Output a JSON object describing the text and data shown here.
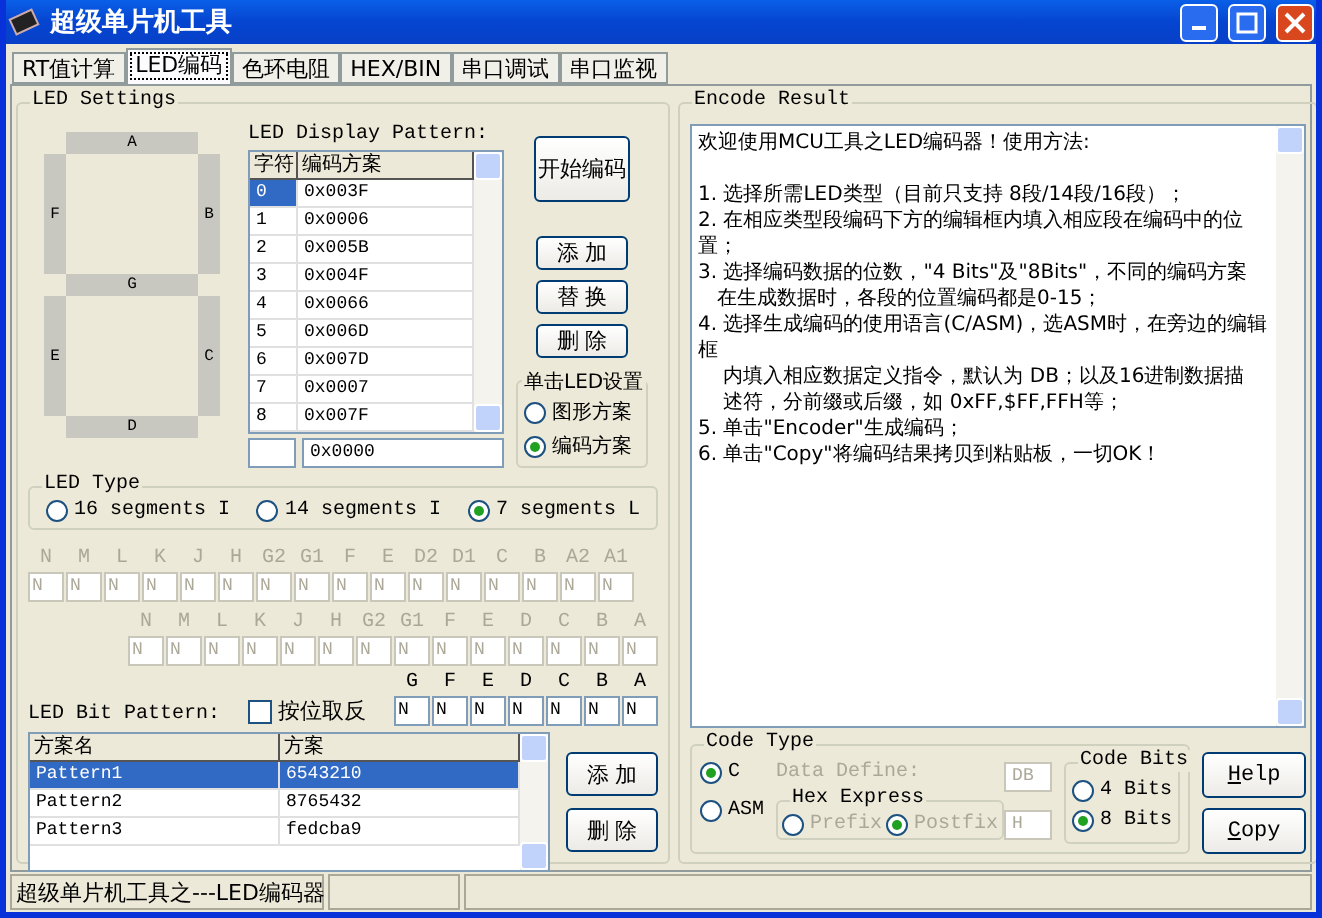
{
  "window": {
    "title": "超级单片机工具"
  },
  "tabs": [
    {
      "label": "RT值计算",
      "selected": false
    },
    {
      "label": "LED编码",
      "selected": true
    },
    {
      "label": "色环电阻",
      "selected": false
    },
    {
      "label": "HEX/BIN",
      "selected": false
    },
    {
      "label": "串口调试",
      "selected": false
    },
    {
      "label": "串口监视",
      "selected": false
    }
  ],
  "led_settings": {
    "title": "LED Settings",
    "segments": [
      "A",
      "F",
      "B",
      "G",
      "E",
      "C",
      "D"
    ],
    "pattern_title": "LED Display Pattern:",
    "pattern_columns": [
      "字符",
      "编码方案"
    ],
    "pattern_rows": [
      {
        "char": "0",
        "code": "0x003F",
        "selected": true
      },
      {
        "char": "1",
        "code": "0x0006",
        "selected": false
      },
      {
        "char": "2",
        "code": "0x005B",
        "selected": false
      },
      {
        "char": "3",
        "code": "0x004F",
        "selected": false
      },
      {
        "char": "4",
        "code": "0x0066",
        "selected": false
      },
      {
        "char": "5",
        "code": "0x006D",
        "selected": false
      },
      {
        "char": "6",
        "code": "0x007D",
        "selected": false
      },
      {
        "char": "7",
        "code": "0x0007",
        "selected": false
      },
      {
        "char": "8",
        "code": "0x007F",
        "selected": false
      }
    ],
    "code_input": "0x0000",
    "start_button": "开始编码",
    "buttons": [
      "添 加",
      "替 换",
      "删 除"
    ],
    "click_setting": {
      "title": "单击LED设置",
      "options": [
        {
          "label": "图形方案",
          "selected": false
        },
        {
          "label": "编码方案",
          "selected": true
        }
      ]
    }
  },
  "led_type": {
    "title": "LED Type",
    "options": [
      {
        "label": "16 segments I",
        "selected": false
      },
      {
        "label": "14 segments I",
        "selected": false
      },
      {
        "label": "7 segments L",
        "selected": true
      }
    ]
  },
  "segment_rows": [
    {
      "disabled": true,
      "fields": [
        {
          "label": "N",
          "value": "N"
        },
        {
          "label": "M",
          "value": "N"
        },
        {
          "label": "L",
          "value": "N"
        },
        {
          "label": "K",
          "value": "N"
        },
        {
          "label": "J",
          "value": "N"
        },
        {
          "label": "H",
          "value": "N"
        },
        {
          "label": "G2",
          "value": "N"
        },
        {
          "label": "G1",
          "value": "N"
        },
        {
          "label": "F",
          "value": "N"
        },
        {
          "label": "E",
          "value": "N"
        },
        {
          "label": "D2",
          "value": "N"
        },
        {
          "label": "D1",
          "value": "N"
        },
        {
          "label": "C",
          "value": "N"
        },
        {
          "label": "B",
          "value": "N"
        },
        {
          "label": "A2",
          "value": "N"
        },
        {
          "label": "A1",
          "value": "N"
        }
      ]
    },
    {
      "disabled": true,
      "fields": [
        {
          "label": "N",
          "value": "N"
        },
        {
          "label": "M",
          "value": "N"
        },
        {
          "label": "L",
          "value": "N"
        },
        {
          "label": "K",
          "value": "N"
        },
        {
          "label": "J",
          "value": "N"
        },
        {
          "label": "H",
          "value": "N"
        },
        {
          "label": "G2",
          "value": "N"
        },
        {
          "label": "G1",
          "value": "N"
        },
        {
          "label": "F",
          "value": "N"
        },
        {
          "label": "E",
          "value": "N"
        },
        {
          "label": "D",
          "value": "N"
        },
        {
          "label": "C",
          "value": "N"
        },
        {
          "label": "B",
          "value": "N"
        },
        {
          "label": "A",
          "value": "N"
        }
      ]
    },
    {
      "disabled": false,
      "fields": [
        {
          "label": "G",
          "value": "N"
        },
        {
          "label": "F",
          "value": "N"
        },
        {
          "label": "E",
          "value": "N"
        },
        {
          "label": "D",
          "value": "N"
        },
        {
          "label": "C",
          "value": "N"
        },
        {
          "label": "B",
          "value": "N"
        },
        {
          "label": "A",
          "value": "N"
        }
      ]
    }
  ],
  "bit_pattern": {
    "title": "LED Bit Pattern:",
    "invert": {
      "label": "按位取反",
      "checked": false
    },
    "columns": [
      "方案名",
      "方案"
    ],
    "rows": [
      {
        "name": "Pattern1",
        "pattern": "6543210",
        "selected": true
      },
      {
        "name": "Pattern2",
        "pattern": "8765432",
        "selected": false
      },
      {
        "name": "Pattern3",
        "pattern": "fedcba9",
        "selected": false
      }
    ],
    "buttons": [
      "添 加",
      "删 除"
    ]
  },
  "encode_result": {
    "title": "Encode Result",
    "paragraphs": [
      {
        "text": "欢迎使用MCU工具之LED编码器！使用方法:",
        "gap_after": true
      },
      {
        "text": "1. 选择所需LED类型（目前只支持 8段/14段/16段）；",
        "gap_after": false
      },
      {
        "text": "2. 在相应类型段编码下方的编辑框内填入相应段在编码中的位置；",
        "gap_after": false
      },
      {
        "text": "3. 选择编码数据的位数，\"4 Bits\"及\"8Bits\"，不同的编码方案",
        "gap_after": false
      },
      {
        "text": "   在生成数据时，各段的位置编码都是0-15；",
        "gap_after": false
      },
      {
        "text": "4. 选择生成编码的使用语言(C/ASM)，选ASM时，在旁边的编辑框",
        "gap_after": false
      },
      {
        "text": "    内填入相应数据定义指令，默认为 DB；以及16进制数据描",
        "gap_after": false
      },
      {
        "text": "    述符，分前缀或后缀，如 0xFF,$FF,FFH等；",
        "gap_after": false
      },
      {
        "text": "5. 单击\"Encoder\"生成编码；",
        "gap_after": false
      },
      {
        "text": "6. 单击\"Copy\"将编码结果拷贝到粘贴板，一切OK！",
        "gap_after": false
      }
    ]
  },
  "code_type": {
    "title": "Code Type",
    "options": [
      {
        "label": "C",
        "selected": true
      },
      {
        "label": "ASM",
        "selected": false
      }
    ],
    "data_define": {
      "label": "Data Define:",
      "value": "DB",
      "disabled": true
    },
    "hex_express": {
      "title": "Hex Express",
      "disabled": true,
      "options": [
        {
          "label": "Prefix",
          "selected": false
        },
        {
          "label": "Postfix",
          "selected": true
        }
      ],
      "value": "H"
    }
  },
  "code_bits": {
    "title": "Code Bits",
    "options": [
      {
        "label": "4 Bits",
        "selected": false
      },
      {
        "label": "8 Bits",
        "selected": true
      }
    ]
  },
  "action_buttons": [
    {
      "label": "Help"
    },
    {
      "label": "Copy"
    }
  ],
  "status_bar": {
    "text": "超级单片机工具之---LED编码器"
  }
}
